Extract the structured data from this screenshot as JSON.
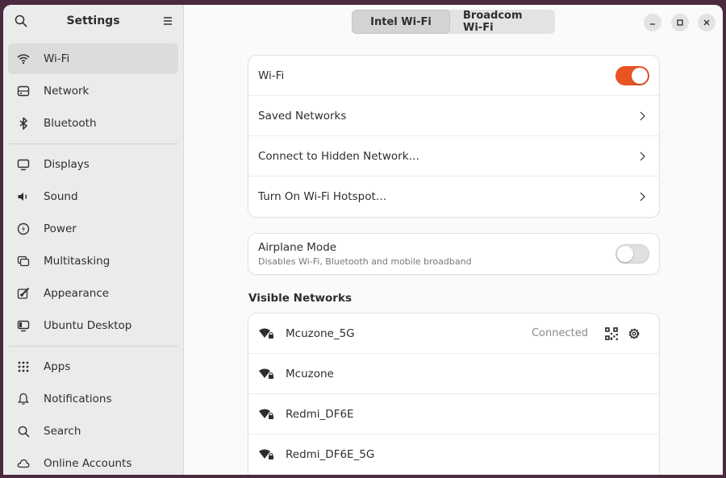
{
  "sidebar": {
    "title": "Settings",
    "groups": [
      [
        {
          "label": "Wi-Fi",
          "icon": "wifi-icon",
          "active": true
        },
        {
          "label": "Network",
          "icon": "network-icon"
        },
        {
          "label": "Bluetooth",
          "icon": "bluetooth-icon"
        }
      ],
      [
        {
          "label": "Displays",
          "icon": "display-icon"
        },
        {
          "label": "Sound",
          "icon": "sound-icon"
        },
        {
          "label": "Power",
          "icon": "power-icon"
        },
        {
          "label": "Multitasking",
          "icon": "multitasking-icon"
        },
        {
          "label": "Appearance",
          "icon": "appearance-icon"
        },
        {
          "label": "Ubuntu Desktop",
          "icon": "ubuntu-desktop-icon"
        }
      ],
      [
        {
          "label": "Apps",
          "icon": "apps-icon"
        },
        {
          "label": "Notifications",
          "icon": "notifications-icon"
        },
        {
          "label": "Search",
          "icon": "search-icon"
        },
        {
          "label": "Online Accounts",
          "icon": "online-accounts-icon"
        }
      ]
    ]
  },
  "header": {
    "tabs": [
      {
        "label": "Intel Wi-Fi",
        "active": true
      },
      {
        "label": "Broadcom Wi-Fi",
        "active": false
      }
    ]
  },
  "wifi_card": {
    "wifi_label": "Wi-Fi",
    "wifi_on": true,
    "saved_networks": "Saved Networks",
    "hidden_network": "Connect to Hidden Network…",
    "hotspot": "Turn On Wi-Fi Hotspot…"
  },
  "airplane": {
    "label": "Airplane Mode",
    "description": "Disables Wi-Fi, Bluetooth and mobile broadband",
    "on": false
  },
  "visible_networks": {
    "title": "Visible Networks",
    "items": [
      {
        "name": "Mcuzone_5G",
        "status": "Connected"
      },
      {
        "name": "Mcuzone",
        "status": ""
      },
      {
        "name": "Redmi_DF6E",
        "status": ""
      },
      {
        "name": "Redmi_DF6E_5G",
        "status": ""
      }
    ]
  },
  "colors": {
    "accent": "#e95420"
  }
}
